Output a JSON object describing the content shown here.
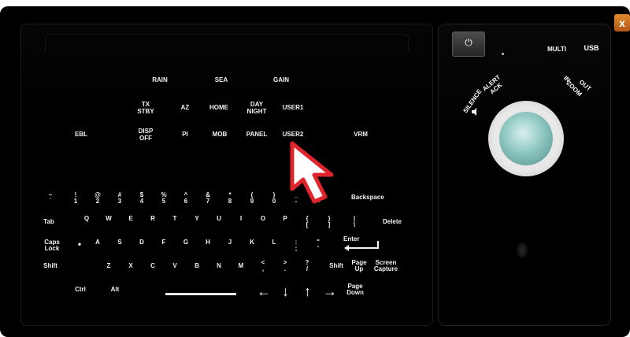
{
  "window": {
    "close_label": "x"
  },
  "function_keys": [
    {
      "name": "rain-key",
      "label": "RAIN"
    },
    {
      "name": "sea-key",
      "label": "SEA"
    },
    {
      "name": "gain-key",
      "label": "GAIN"
    },
    {
      "name": "tx-stby-key",
      "label": "TX\nSTBY"
    },
    {
      "name": "az-key",
      "label": "AZ"
    },
    {
      "name": "home-key",
      "label": "HOME"
    },
    {
      "name": "day-night-key",
      "label": "DAY\nNIGHT"
    },
    {
      "name": "user1-key",
      "label": "USER1"
    },
    {
      "name": "ebl-key",
      "label": "EBL"
    },
    {
      "name": "disp-off-key",
      "label": "DISP\nOFF"
    },
    {
      "name": "pi-key",
      "label": "PI"
    },
    {
      "name": "mob-key",
      "label": "MOB"
    },
    {
      "name": "panel-key",
      "label": "PANEL"
    },
    {
      "name": "user2-key",
      "label": "USER2"
    },
    {
      "name": "vrm-key",
      "label": "VRM"
    }
  ],
  "keyboard": {
    "row1": [
      "~\n`",
      "!\n1",
      "@\n2",
      "#\n3",
      "$\n4",
      "%\n5",
      "^\n6",
      "&\n7",
      "*\n8",
      "(\n9",
      ")\n0",
      "_\n-",
      "+\n="
    ],
    "backspace": "Backspace",
    "tab": "Tab",
    "row2": [
      "Q",
      "W",
      "E",
      "R",
      "T",
      "Y",
      "U",
      "I",
      "O",
      "P",
      "{\n[",
      "}\n]",
      "|\n\\"
    ],
    "delete": "Delete",
    "caps_lock": "Caps\nLock",
    "caps_indicator": "•",
    "row3": [
      "A",
      "S",
      "D",
      "F",
      "G",
      "H",
      "J",
      "K",
      "L",
      ":\n;",
      "\"\n'"
    ],
    "enter": "Enter",
    "shift_left": "Shift",
    "row4": [
      "Z",
      "X",
      "C",
      "V",
      "B",
      "N",
      "M",
      "<\n,",
      ">\n.",
      "?\n/"
    ],
    "shift_right": "Shift",
    "page_up": "Page\nUp",
    "screen_capture": "Screen\nCapture",
    "ctrl": "Ctrl",
    "alt": "Alt",
    "arrow_left": "←",
    "arrow_down": "↓",
    "arrow_up": "↑",
    "arrow_right": "→",
    "page_down": "Page\nDown"
  },
  "right_panel": {
    "power_symbol": "⏻",
    "multi": "MULTI",
    "usb": "USB",
    "alert_ack": "ALERT\nACK",
    "silence": "SILENCE",
    "in": "IN",
    "zoom": "ZOOM",
    "out": "OUT"
  },
  "colors": {
    "background": "#000000",
    "close_accent": "#d2712a",
    "trackball": "#8fc7c1"
  }
}
